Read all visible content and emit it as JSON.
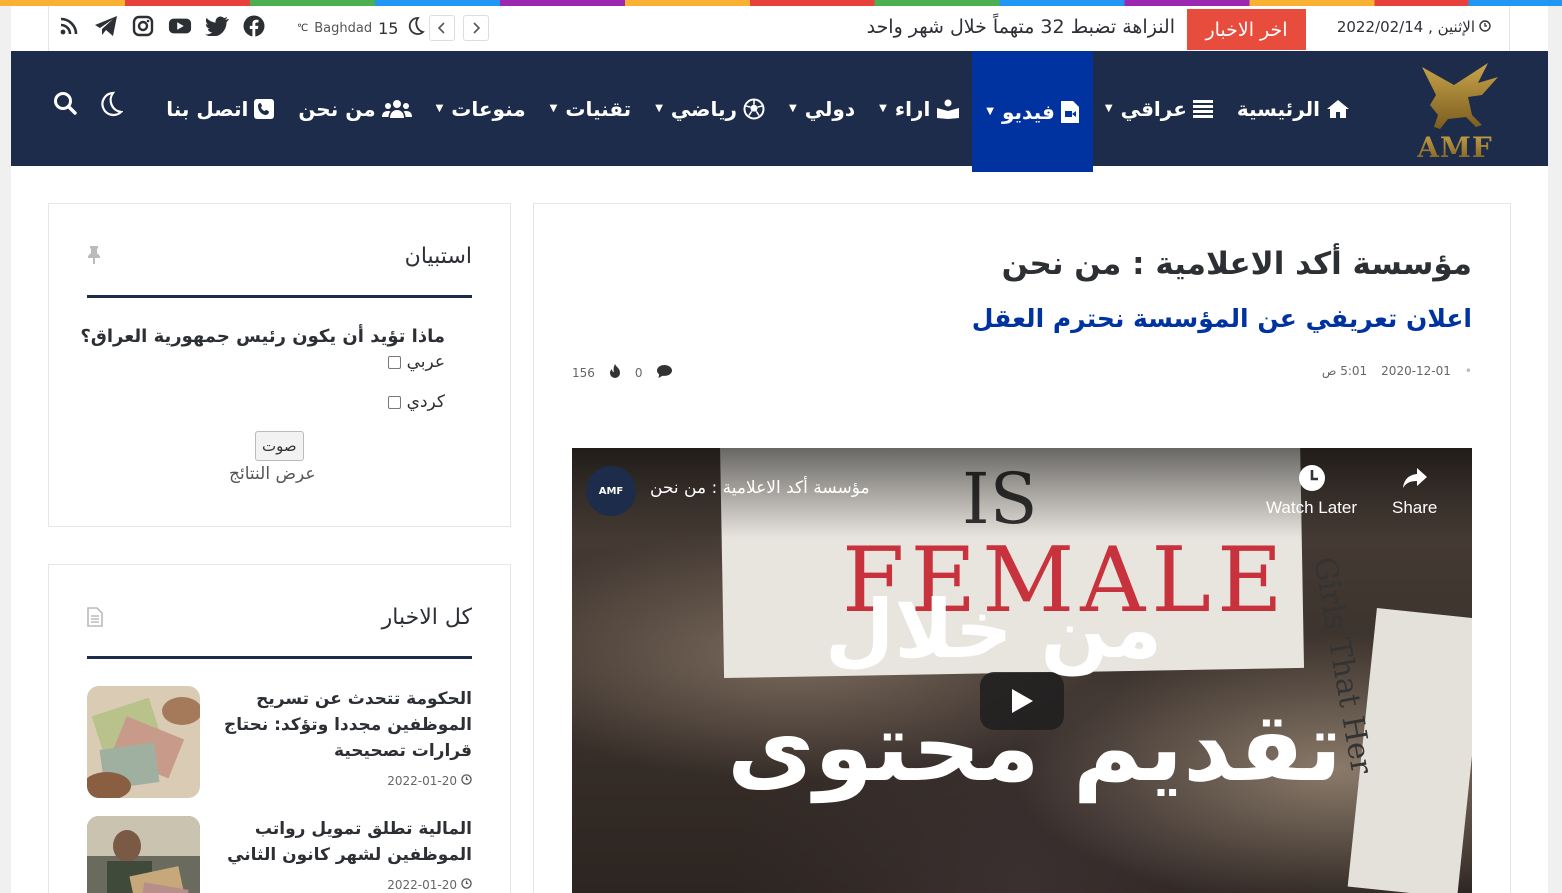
{
  "topbar": {
    "date": "الإثنين , 2022/02/14",
    "breaking_label": "اخر الاخبار",
    "breaking_text": "النزاهة تضبط 32 متهماً خلال شهر واحد",
    "weather_city": "Baghdad",
    "weather_temp": "15",
    "weather_unit": "℃",
    "social": [
      "facebook-icon",
      "twitter-icon",
      "youtube-icon",
      "instagram-icon",
      "telegram-icon",
      "rss-icon"
    ]
  },
  "nav": {
    "logo_text": "AMF",
    "items": [
      {
        "label": "الرئيسية",
        "icon": "home-icon"
      },
      {
        "label": "عراقي",
        "icon": "list-icon"
      },
      {
        "label": "فيديو",
        "icon": "video-file-icon"
      },
      {
        "label": "اراء",
        "icon": "reader-icon"
      },
      {
        "label": "دولي",
        "icon": ""
      },
      {
        "label": "رياضي",
        "icon": "football-icon"
      },
      {
        "label": "تقنيات",
        "icon": ""
      },
      {
        "label": "منوعات",
        "icon": ""
      },
      {
        "label": "من نحن",
        "icon": "users-icon"
      },
      {
        "label": "اتصل بنا",
        "icon": "phone-icon"
      }
    ]
  },
  "article": {
    "title": "مؤسسة أكد الاعلامية : من نحن",
    "subtitle": "اعلان تعريفي عن المؤسسة نحترم العقل",
    "date": "2020-12-01",
    "time": "5:01 ص",
    "comments": "0",
    "views": "156"
  },
  "video": {
    "title": "مؤسسة أكد الاعلامية : من نحن",
    "channel_text": "AMF",
    "watch_later": "Watch Later",
    "share": "Share",
    "sign_text_1": "IS",
    "sign_text_2": "FEMALE",
    "sign2_text": "Girls That Her",
    "overlay_line_1": "من خلال",
    "overlay_line_2": "تقديم محتوى"
  },
  "poll": {
    "title": "استبيان",
    "question": "ماذا تؤيد أن يكون رئيس جمهورية العراق؟",
    "options": [
      "عربي",
      "كردي"
    ],
    "vote_label": "صوت",
    "results_label": "عرض النتائج"
  },
  "news_widget": {
    "title": "كل الاخبار",
    "items": [
      {
        "title": "الحكومة تتحدث عن تسريح الموظفين مجددا وتؤكد: نحتاج قرارات تصحيحية",
        "date": "2022-01-20"
      },
      {
        "title": "المالية تطلق تمويل رواتب الموظفين لشهر كانون الثاني",
        "date": "2022-01-20"
      }
    ]
  }
}
